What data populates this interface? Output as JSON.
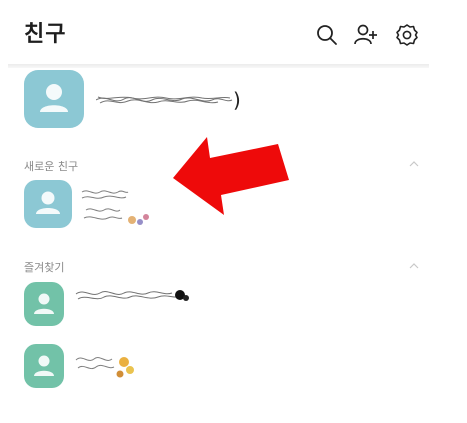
{
  "header": {
    "title": "친구",
    "icons": [
      "search-icon",
      "add-friend-icon",
      "settings-icon"
    ]
  },
  "my_profile": {
    "name_suffix": ")",
    "avatar_color": "#8cc8d4"
  },
  "sections": [
    {
      "label": "새로운 친구",
      "avatar_color": "#8cc8d4"
    },
    {
      "label": "즐겨찾기",
      "avatar_color": "#72c2a8"
    }
  ],
  "colors": {
    "arrow": "#ee0a0a",
    "section_label": "#8a8a8a"
  }
}
